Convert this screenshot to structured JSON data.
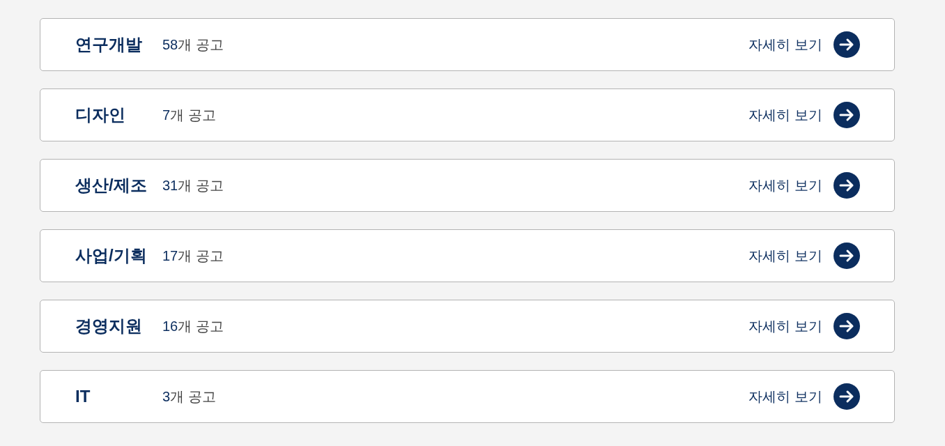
{
  "categories": [
    {
      "title": "연구개발",
      "count": "58",
      "count_suffix": "개 공고",
      "link": "자세히 보기"
    },
    {
      "title": "디자인",
      "count": "7",
      "count_suffix": "개 공고",
      "link": "자세히 보기"
    },
    {
      "title": "생산/제조",
      "count": "31",
      "count_suffix": "개 공고",
      "link": "자세히 보기"
    },
    {
      "title": "사업/기획",
      "count": "17",
      "count_suffix": "개 공고",
      "link": "자세히 보기"
    },
    {
      "title": "경영지원",
      "count": "16",
      "count_suffix": "개 공고",
      "link": "자세히 보기"
    },
    {
      "title": "IT",
      "count": "3",
      "count_suffix": "개 공고",
      "link": "자세히 보기"
    }
  ]
}
